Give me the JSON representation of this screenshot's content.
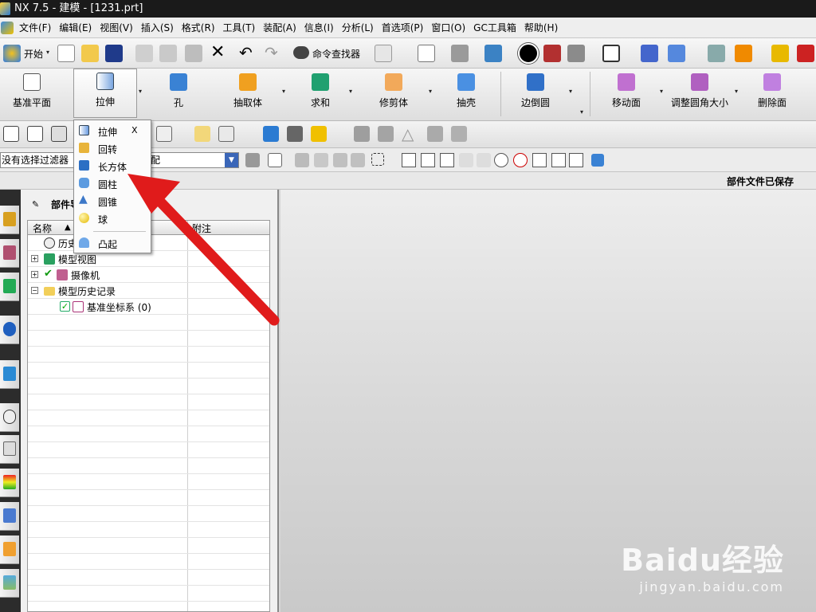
{
  "window": {
    "title": "NX 7.5 - 建模 - [1231.prt]"
  },
  "menubar": {
    "items": [
      "文件(F)",
      "编辑(E)",
      "视图(V)",
      "插入(S)",
      "格式(R)",
      "工具(T)",
      "装配(A)",
      "信息(I)",
      "分析(L)",
      "首选项(P)",
      "窗口(O)",
      "GC工具箱",
      "帮助(H)"
    ]
  },
  "toolbar": {
    "start_label": "开始",
    "command_finder_label": "命令查找器"
  },
  "feature_toolbar": {
    "datum_plane": "基准平面",
    "extrude": "拉伸",
    "hole": "孔",
    "extract": "抽取体",
    "unite": "求和",
    "trim_body": "修剪体",
    "shell": "抽壳",
    "edge_blend": "边倒圆",
    "move_face": "移动面",
    "resize_blend": "调整圆角大小",
    "delete_face": "删除面"
  },
  "dropdown_menu": {
    "close_label": "X",
    "items": [
      "拉伸",
      "回转",
      "长方体",
      "圆柱",
      "圆锥",
      "球",
      "凸起"
    ]
  },
  "selection_bar": {
    "filter_text": "没有选择过滤器",
    "scope_text": "配"
  },
  "status": {
    "text": "部件文件已保存"
  },
  "navigator": {
    "title": "部件导",
    "columns": {
      "name": "名称",
      "note": "附注"
    },
    "nodes": [
      "历史",
      "模型视图",
      "摄像机",
      "模型历史记录",
      "基准坐标系 (0)"
    ]
  },
  "watermark": {
    "brand": "Baidu经验",
    "url": "jingyan.baidu.com"
  },
  "colors": {
    "titlebar": "#1a1a1a",
    "arrow": "#e01b1b",
    "dropdown_arrow_bg": "#3a66b8"
  }
}
